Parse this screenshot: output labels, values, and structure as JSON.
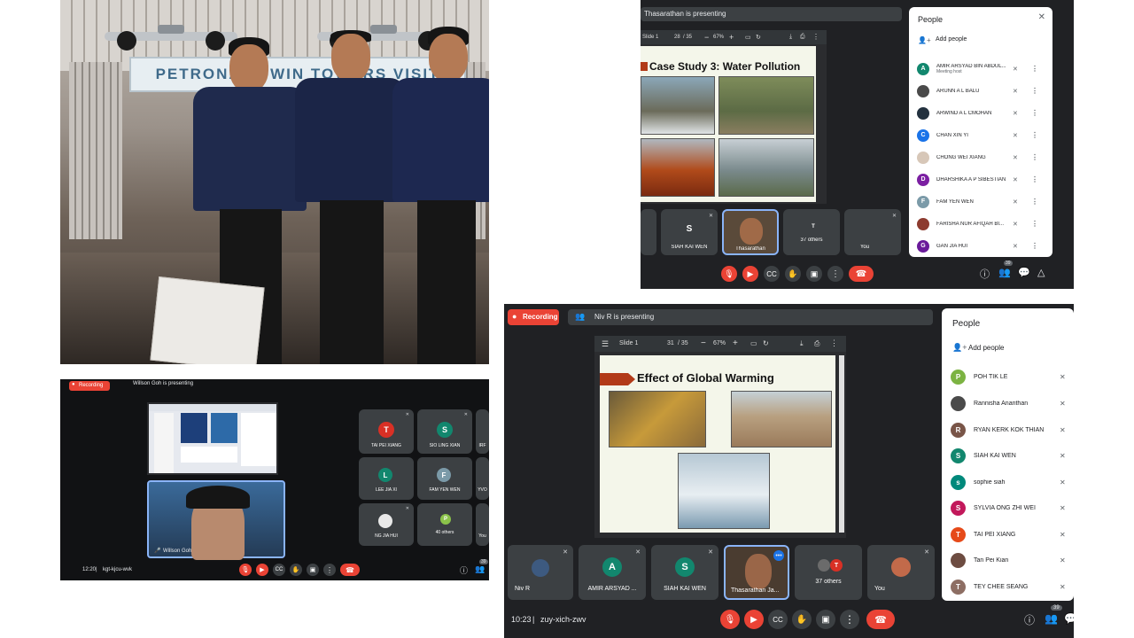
{
  "photo": {
    "sign_text": "PETRONAS TWIN TOWERS VISIT"
  },
  "meet_top": {
    "presenting": "Thasarathan is presenting",
    "slide_label": "Slide 1",
    "page_current": "28",
    "page_total": "/ 35",
    "zoom": "67%",
    "slide_title": "Case Study 3: Water Pollution",
    "tiles": [
      {
        "name": "SIAH KAI WEN",
        "initial": "S",
        "color": "#12876e"
      },
      {
        "name": "Thasarathan",
        "initial": "",
        "color": "#5a4a3a"
      },
      {
        "name": "37 others",
        "initial": "T",
        "color": "#d93025"
      },
      {
        "name": "You",
        "initial": "",
        "color": "#c26a4a"
      }
    ],
    "people": {
      "title": "People",
      "add_label": "Add people",
      "host_sub": "Meeting host",
      "participant_count": "39",
      "list": [
        {
          "name": "AMIR ARSYAD BIN ABDUL...",
          "initial": "A",
          "color": "#12876e"
        },
        {
          "name": "ARUNN A L BALU",
          "initial": "",
          "color": "#4a4a4a"
        },
        {
          "name": "ARWIND A L CMOHAN",
          "initial": "",
          "color": "#23313f"
        },
        {
          "name": "CHAN XIN YI",
          "initial": "C",
          "color": "#1a73e8"
        },
        {
          "name": "CHONG WEI XIANG",
          "initial": "",
          "color": "#d7c7b8"
        },
        {
          "name": "DHARSHIKA A P SIBESTIAN",
          "initial": "D",
          "color": "#7b1fa2"
        },
        {
          "name": "FAM YEN WEN",
          "initial": "F",
          "color": "#7b9aa8"
        },
        {
          "name": "FARISHA NUR AFIQAH BI...",
          "initial": "",
          "color": "#8d3b2f"
        },
        {
          "name": "GAN JIA HUI",
          "initial": "G",
          "color": "#6a1b9a"
        }
      ]
    }
  },
  "meet_left": {
    "recording": "Recording",
    "presenting": "Willson Goh is presenting",
    "presenter_name": "Willson Goh",
    "time": "12:20",
    "code": "kgt-kjcu-wvk",
    "participant_count": "39",
    "tiles": [
      {
        "name": "TAI PEI XIANG",
        "initial": "T",
        "color": "#d93025"
      },
      {
        "name": "SIO LING XIAN",
        "initial": "S",
        "color": "#12876e"
      },
      {
        "name": "IRF",
        "initial": "",
        "color": "#3c4043"
      },
      {
        "name": "LEE JIA XI",
        "initial": "L",
        "color": "#12876e"
      },
      {
        "name": "FAM YEN WEN",
        "initial": "F",
        "color": "#7b9aa8"
      },
      {
        "name": "YVO",
        "initial": "",
        "color": "#3c4043"
      },
      {
        "name": "NG JIA HUI",
        "initial": "",
        "color": "#e8e8e8"
      },
      {
        "name": "40 others",
        "initial": "P",
        "color": "#8bc34a"
      },
      {
        "name": "You",
        "initial": "",
        "color": "#3c4043"
      }
    ]
  },
  "meet_main": {
    "recording": "Recording",
    "presenting": "Niv R is presenting",
    "slide_label": "Slide 1",
    "page_current": "31",
    "page_total": "/ 35",
    "zoom": "67%",
    "slide_title": "Effect of Global Warming",
    "time": "10:23",
    "code": "zuy-xich-zwv",
    "participant_count": "39",
    "tiles": [
      {
        "name": "Niv R",
        "initial": "",
        "color": "#3d5a80"
      },
      {
        "name": "AMIR ARSYAD ...",
        "initial": "A",
        "color": "#12876e"
      },
      {
        "name": "SIAH KAI WEN",
        "initial": "S",
        "color": "#12876e"
      },
      {
        "name": "Thasarathan Ja...",
        "initial": "",
        "color": "#5a4a3a"
      },
      {
        "name": "37 others",
        "initial": "T",
        "color": "#d93025"
      },
      {
        "name": "You",
        "initial": "",
        "color": "#c26a4a"
      }
    ],
    "people": {
      "title": "People",
      "add_label": "Add people",
      "list": [
        {
          "name": "POH TIK LE",
          "initial": "P",
          "color": "#7cb342"
        },
        {
          "name": "Rannisha Ananthan",
          "initial": "",
          "color": "#4a4a4a"
        },
        {
          "name": "RYAN KERK KOK THIAN",
          "initial": "R",
          "color": "#795548"
        },
        {
          "name": "SIAH KAI WEN",
          "initial": "S",
          "color": "#12876e"
        },
        {
          "name": "sophie siah",
          "initial": "s",
          "color": "#00897b"
        },
        {
          "name": "SYLVIA ONG ZHI WEI",
          "initial": "S",
          "color": "#c2185b"
        },
        {
          "name": "TAI PEI XIANG",
          "initial": "T",
          "color": "#e64a19"
        },
        {
          "name": "Tan Pei Kian",
          "initial": "",
          "color": "#6d4c41"
        },
        {
          "name": "TEY CHEE SEANG",
          "initial": "T",
          "color": "#8d6e63"
        }
      ]
    }
  }
}
